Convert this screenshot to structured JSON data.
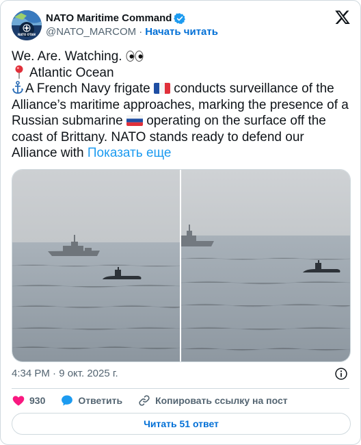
{
  "author": {
    "display_name": "NATO Maritime Command",
    "handle": "@NATO_MARCOM",
    "separator": "·",
    "follow_label": "Начать читать",
    "avatar_text": "NATO OTAN"
  },
  "tweet": {
    "line1": "We. Are. Watching. ",
    "line2": "Atlantic Ocean",
    "line3_a": "A French Navy frigate ",
    "line3_b": " conducts surveillance of the Alliance’s maritime approaches, marking the presence of a Russian submarine ",
    "line3_c": " operating on the surface off the coast of Brittany. NATO stands ready to defend our Alliance with ",
    "show_more": "Показать еще"
  },
  "meta": {
    "timestamp": "4:34 PM · 9 окт. 2025 г."
  },
  "actions": {
    "like_count": "930",
    "reply_label": "Ответить",
    "copy_link_label": "Копировать ссылку на пост"
  },
  "read_replies_label": "Читать 51 ответ",
  "icons": {
    "verified": "verified-badge-icon",
    "x_logo": "x-logo-icon",
    "info": "info-icon",
    "like": "heart-icon",
    "reply": "speech-bubble-icon",
    "link": "link-icon"
  },
  "colors": {
    "accent": "#1d9bf0",
    "follow": "#006fd6",
    "heart": "#f91880",
    "muted": "#536471"
  }
}
